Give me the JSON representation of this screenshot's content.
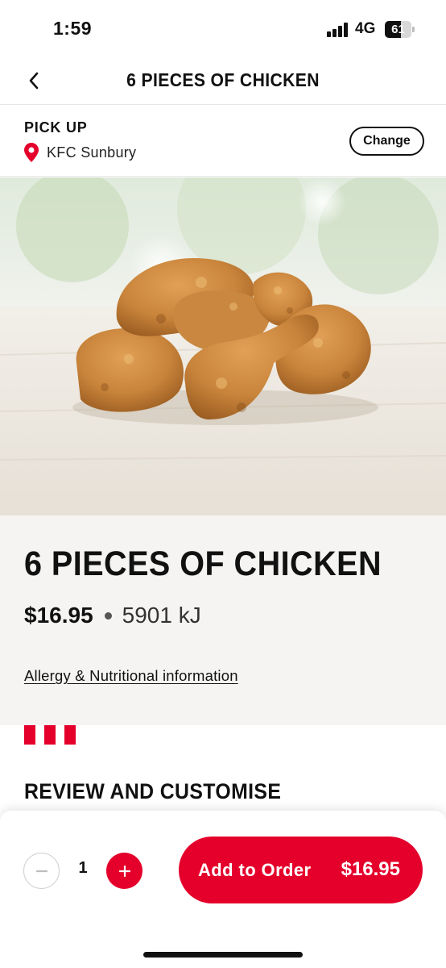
{
  "status_bar": {
    "time": "1:59",
    "network": "4G",
    "battery": "61",
    "battery_level": 0.61
  },
  "header": {
    "title": "6 PIECES OF CHICKEN",
    "back_icon": "chevron-left-icon"
  },
  "pickup": {
    "label": "PICK UP",
    "store": "KFC Sunbury",
    "change_label": "Change",
    "pin_icon": "location-pin-icon"
  },
  "product": {
    "title": "6 PIECES OF CHICKEN",
    "price": "$16.95",
    "energy": "5901 kJ",
    "allergy_link": "Allergy & Nutritional information"
  },
  "review": {
    "title": "REVIEW AND CUSTOMISE"
  },
  "order_bar": {
    "quantity": "1",
    "minus_icon": "minus-icon",
    "plus_icon": "plus-icon",
    "add_label": "Add to Order",
    "add_price": "$16.95"
  },
  "colors": {
    "brand_red": "#e4002b",
    "text": "#111111",
    "info_bg": "#f5f4f2"
  }
}
